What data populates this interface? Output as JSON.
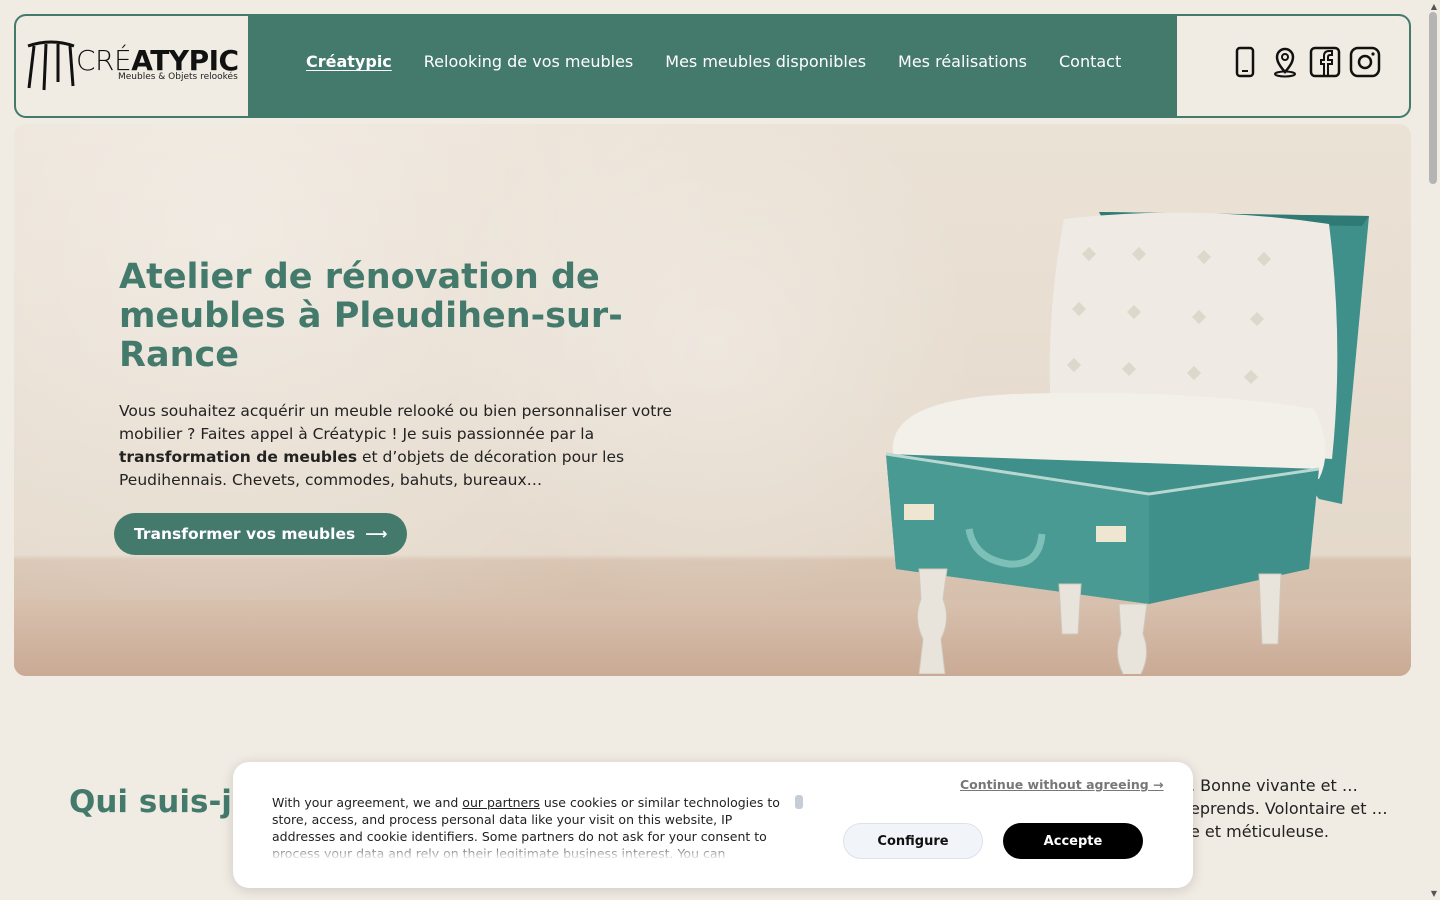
{
  "logo": {
    "word_thin": "CRÉ",
    "word_bold": "ATYPIC",
    "tagline": "Meubles & Objets relookés"
  },
  "nav": {
    "items": [
      {
        "label": "Créatypic",
        "active": true
      },
      {
        "label": "Relooking de vos meubles"
      },
      {
        "label": "Mes meubles disponibles"
      },
      {
        "label": "Mes réalisations"
      },
      {
        "label": "Contact"
      }
    ]
  },
  "social": {
    "icons": [
      "phone-icon",
      "location-pin-icon",
      "facebook-icon",
      "instagram-icon"
    ]
  },
  "hero": {
    "title": "Atelier de rénovation de meubles à Pleudihen-sur-Rance",
    "text_part1": "Vous souhaitez acquérir un meuble relooké ou bien personnaliser votre mobilier ? Faites appel à Créatypic ! Je suis passionnée par la ",
    "text_bold": "transformation de meubles",
    "text_part2": " et d’objets de décoration pour les Peudihennais. Chevets, commodes, bahuts, bureaux…",
    "button_label": "Transformer vos meubles",
    "button_arrow": "⟶"
  },
  "about": {
    "title": "Qui suis-je",
    "text": ". Bonne vivante et …eprends. Volontaire et …e et méticuleuse."
  },
  "cookie": {
    "text_before_link": "With your agreement, we and ",
    "link": "our partners",
    "text_after_link": " use cookies or similar technologies to store, access, and process personal data like your visit on this website, IP addresses and cookie identifiers. Some partners do not ask for your consent to process your data and rely on their legitimate business interest. You can",
    "continue": "Continue without agreeing →",
    "configure": "Configure",
    "accept": "Accepte"
  },
  "colors": {
    "accent": "#447a6c",
    "background": "#f0ebe3"
  }
}
